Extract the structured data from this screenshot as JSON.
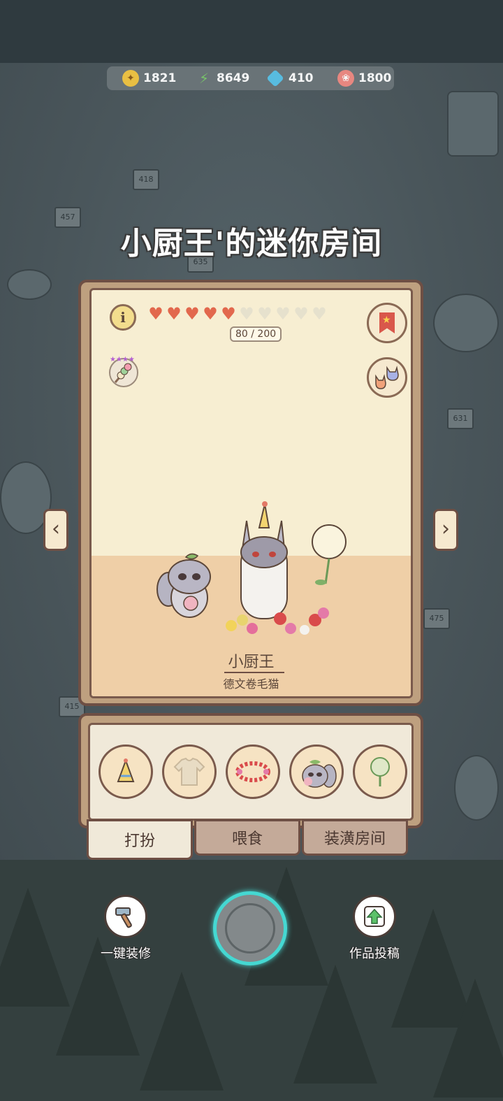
{
  "resources": [
    {
      "name": "coin-icon",
      "value": "1821",
      "color": "#f2c542"
    },
    {
      "name": "energy-icon",
      "value": "8649",
      "color": "#7bc96b"
    },
    {
      "name": "gem-icon",
      "value": "410",
      "color": "#59c2e8"
    },
    {
      "name": "candy-icon",
      "value": "1800",
      "color": "#f08a82"
    }
  ],
  "room": {
    "title": "小厨王'的迷你房间",
    "hearts_filled": 5,
    "hearts_total": 10,
    "hp_label": "80 / 200",
    "pet_name": "小厨王",
    "pet_breed": "德文卷毛猫"
  },
  "tabs": [
    {
      "label": "打扮",
      "active": true
    },
    {
      "label": "喂食",
      "active": false
    },
    {
      "label": "装潢房间",
      "active": false
    }
  ],
  "items": [
    "party-hat",
    "shirt",
    "flower-wreath",
    "raccoon-companion",
    "dandelion"
  ],
  "bottom": {
    "repair_label": "一键装修",
    "submit_label": "作品投稿"
  },
  "colors": {
    "accent": "#45d8d2",
    "frame": "#6e4f44",
    "heart": "#e2684d"
  }
}
